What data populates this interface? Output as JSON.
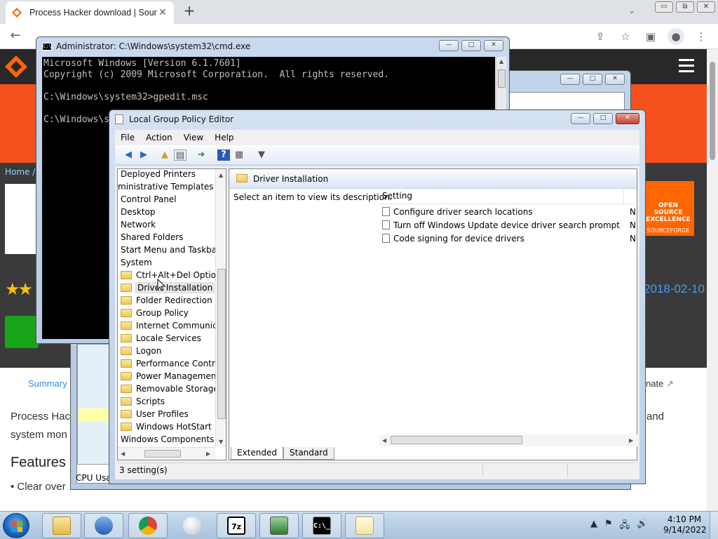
{
  "browser": {
    "tab_title": "Process Hacker download | SourceForge.net",
    "tab_close": "✕",
    "new_tab": "+",
    "tab_search": "⌄",
    "win_min": "▭",
    "win_max": "⧉",
    "win_close": "✕",
    "icons": {
      "back": "arrow-left",
      "forward": "arrow-right",
      "reload": "reload",
      "share": "share",
      "bookmark": "star",
      "sidebar": "side-panel",
      "profile": "person",
      "menu": "kebab"
    }
  },
  "site": {
    "breadcrumb": "Home / ",
    "badge_line1": "OPEN SOURCE EXCELLENCE",
    "badge_line2": "SOURCEFORGE",
    "date": "2018-02-10",
    "summary_tab": "Summary",
    "donate": "nate",
    "para_line1_left": "Process Hac",
    "para_line1_right": "and",
    "para_line2_left": "system mon",
    "features_heading": "Features",
    "bullet": "• Clear over",
    "accent": "#f4511e"
  },
  "task_window": {
    "cpu_label": "CPU Usa"
  },
  "cmd": {
    "title": "Administrator: C:\\Windows\\system32\\cmd.exe",
    "icon_text": "C:\\",
    "lines": "Microsoft Windows [Version 6.1.7601]\nCopyright (c) 2009 Microsoft Corporation.  All rights reserved.\n\nC:\\Windows\\system32>gpedit.msc\n\nC:\\Windows\\s"
  },
  "gpedit": {
    "title": "Local Group Policy Editor",
    "menu": {
      "file": "File",
      "action": "Action",
      "view": "View",
      "help": "Help"
    },
    "tree": [
      {
        "label": "Deployed Printers",
        "folder": false
      },
      {
        "label": "ministrative Templates",
        "folder": false
      },
      {
        "label": "Control Panel",
        "folder": false
      },
      {
        "label": "Desktop",
        "folder": false
      },
      {
        "label": "Network",
        "folder": false
      },
      {
        "label": "Shared Folders",
        "folder": false
      },
      {
        "label": "Start Menu and Taskbar",
        "folder": false
      },
      {
        "label": "System",
        "folder": false
      },
      {
        "label": "Ctrl+Alt+Del Options",
        "folder": true
      },
      {
        "label": "Driver Installation",
        "folder": true
      },
      {
        "label": "Folder Redirection",
        "folder": true
      },
      {
        "label": "Group Policy",
        "folder": true
      },
      {
        "label": "Internet Communicat",
        "folder": true
      },
      {
        "label": "Locale Services",
        "folder": true
      },
      {
        "label": "Logon",
        "folder": true
      },
      {
        "label": "Performance Control",
        "folder": true
      },
      {
        "label": "Power Management",
        "folder": true
      },
      {
        "label": "Removable Storage A",
        "folder": true
      },
      {
        "label": "Scripts",
        "folder": true
      },
      {
        "label": "User Profiles",
        "folder": true
      },
      {
        "label": "Windows HotStart",
        "folder": true
      },
      {
        "label": "Windows Components",
        "folder": false
      }
    ],
    "selected_folder": "Driver Installation",
    "description": "Select an item to view its description.",
    "column_setting": "Setting",
    "settings": [
      {
        "name": "Configure driver search locations",
        "state": "N"
      },
      {
        "name": "Turn off Windows Update device driver search prompt",
        "state": "N"
      },
      {
        "name": "Code signing for device drivers",
        "state": "N"
      }
    ],
    "tab_extended": "Extended",
    "tab_standard": "Standard",
    "status": "3 setting(s)"
  },
  "taskbar": {
    "apps": [
      {
        "name": "file-explorer",
        "label": ""
      },
      {
        "name": "media-player",
        "label": ""
      },
      {
        "name": "chrome",
        "label": ""
      },
      {
        "name": "sphere-app",
        "label": ""
      },
      {
        "name": "7zip",
        "label": "7z"
      },
      {
        "name": "task-manager",
        "label": ""
      },
      {
        "name": "cmd",
        "label": "C:\\_"
      },
      {
        "name": "notepad",
        "label": ""
      }
    ],
    "time": "4:10 PM",
    "date": "9/14/2022"
  }
}
